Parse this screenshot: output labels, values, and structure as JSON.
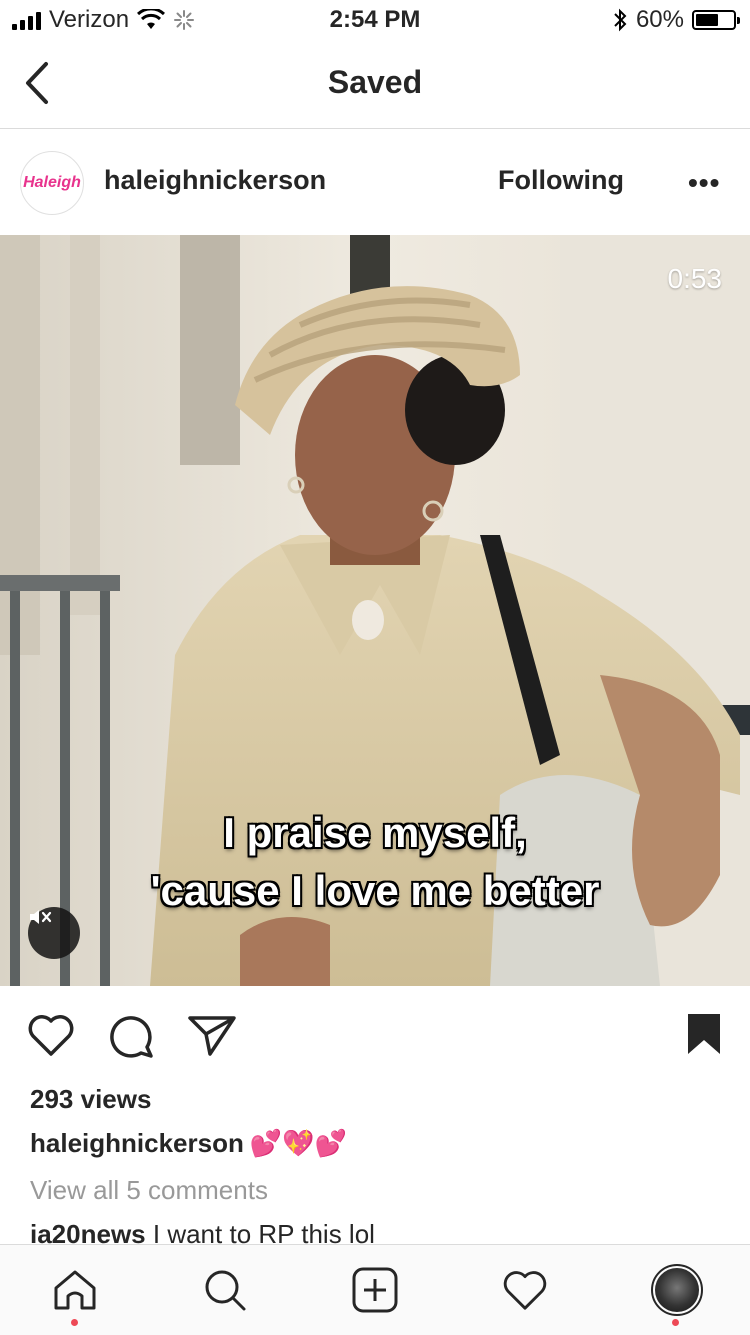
{
  "status_bar": {
    "carrier": "Verizon",
    "time": "2:54 PM",
    "battery_percent": "60%",
    "battery_level": 0.6
  },
  "nav": {
    "title": "Saved",
    "back_icon": "chevron-left-icon"
  },
  "post": {
    "username": "haleighnickerson",
    "avatar_text": "Haleigh",
    "follow_state": "Following",
    "more_label": "•••",
    "video": {
      "duration": "0:53",
      "caption_line1": "I praise myself,",
      "caption_line2": "'cause I love me better",
      "mute_icon": "speaker-muted-icon"
    },
    "views": "293 views",
    "caption": {
      "user": "haleighnickerson",
      "text": "💕💖💕"
    },
    "view_all_comments": "View all 5 comments",
    "first_comment": {
      "user": "ia20news",
      "text": "I want to RP this lol"
    }
  },
  "colors": {
    "text": "#262626",
    "muted": "#999999",
    "notification_dot": "#ed4956",
    "logo_pink": "#e8338d"
  },
  "tab_bar": {
    "items": [
      "home-icon",
      "search-icon",
      "new-post-icon",
      "activity-heart-icon",
      "profile-avatar"
    ]
  }
}
